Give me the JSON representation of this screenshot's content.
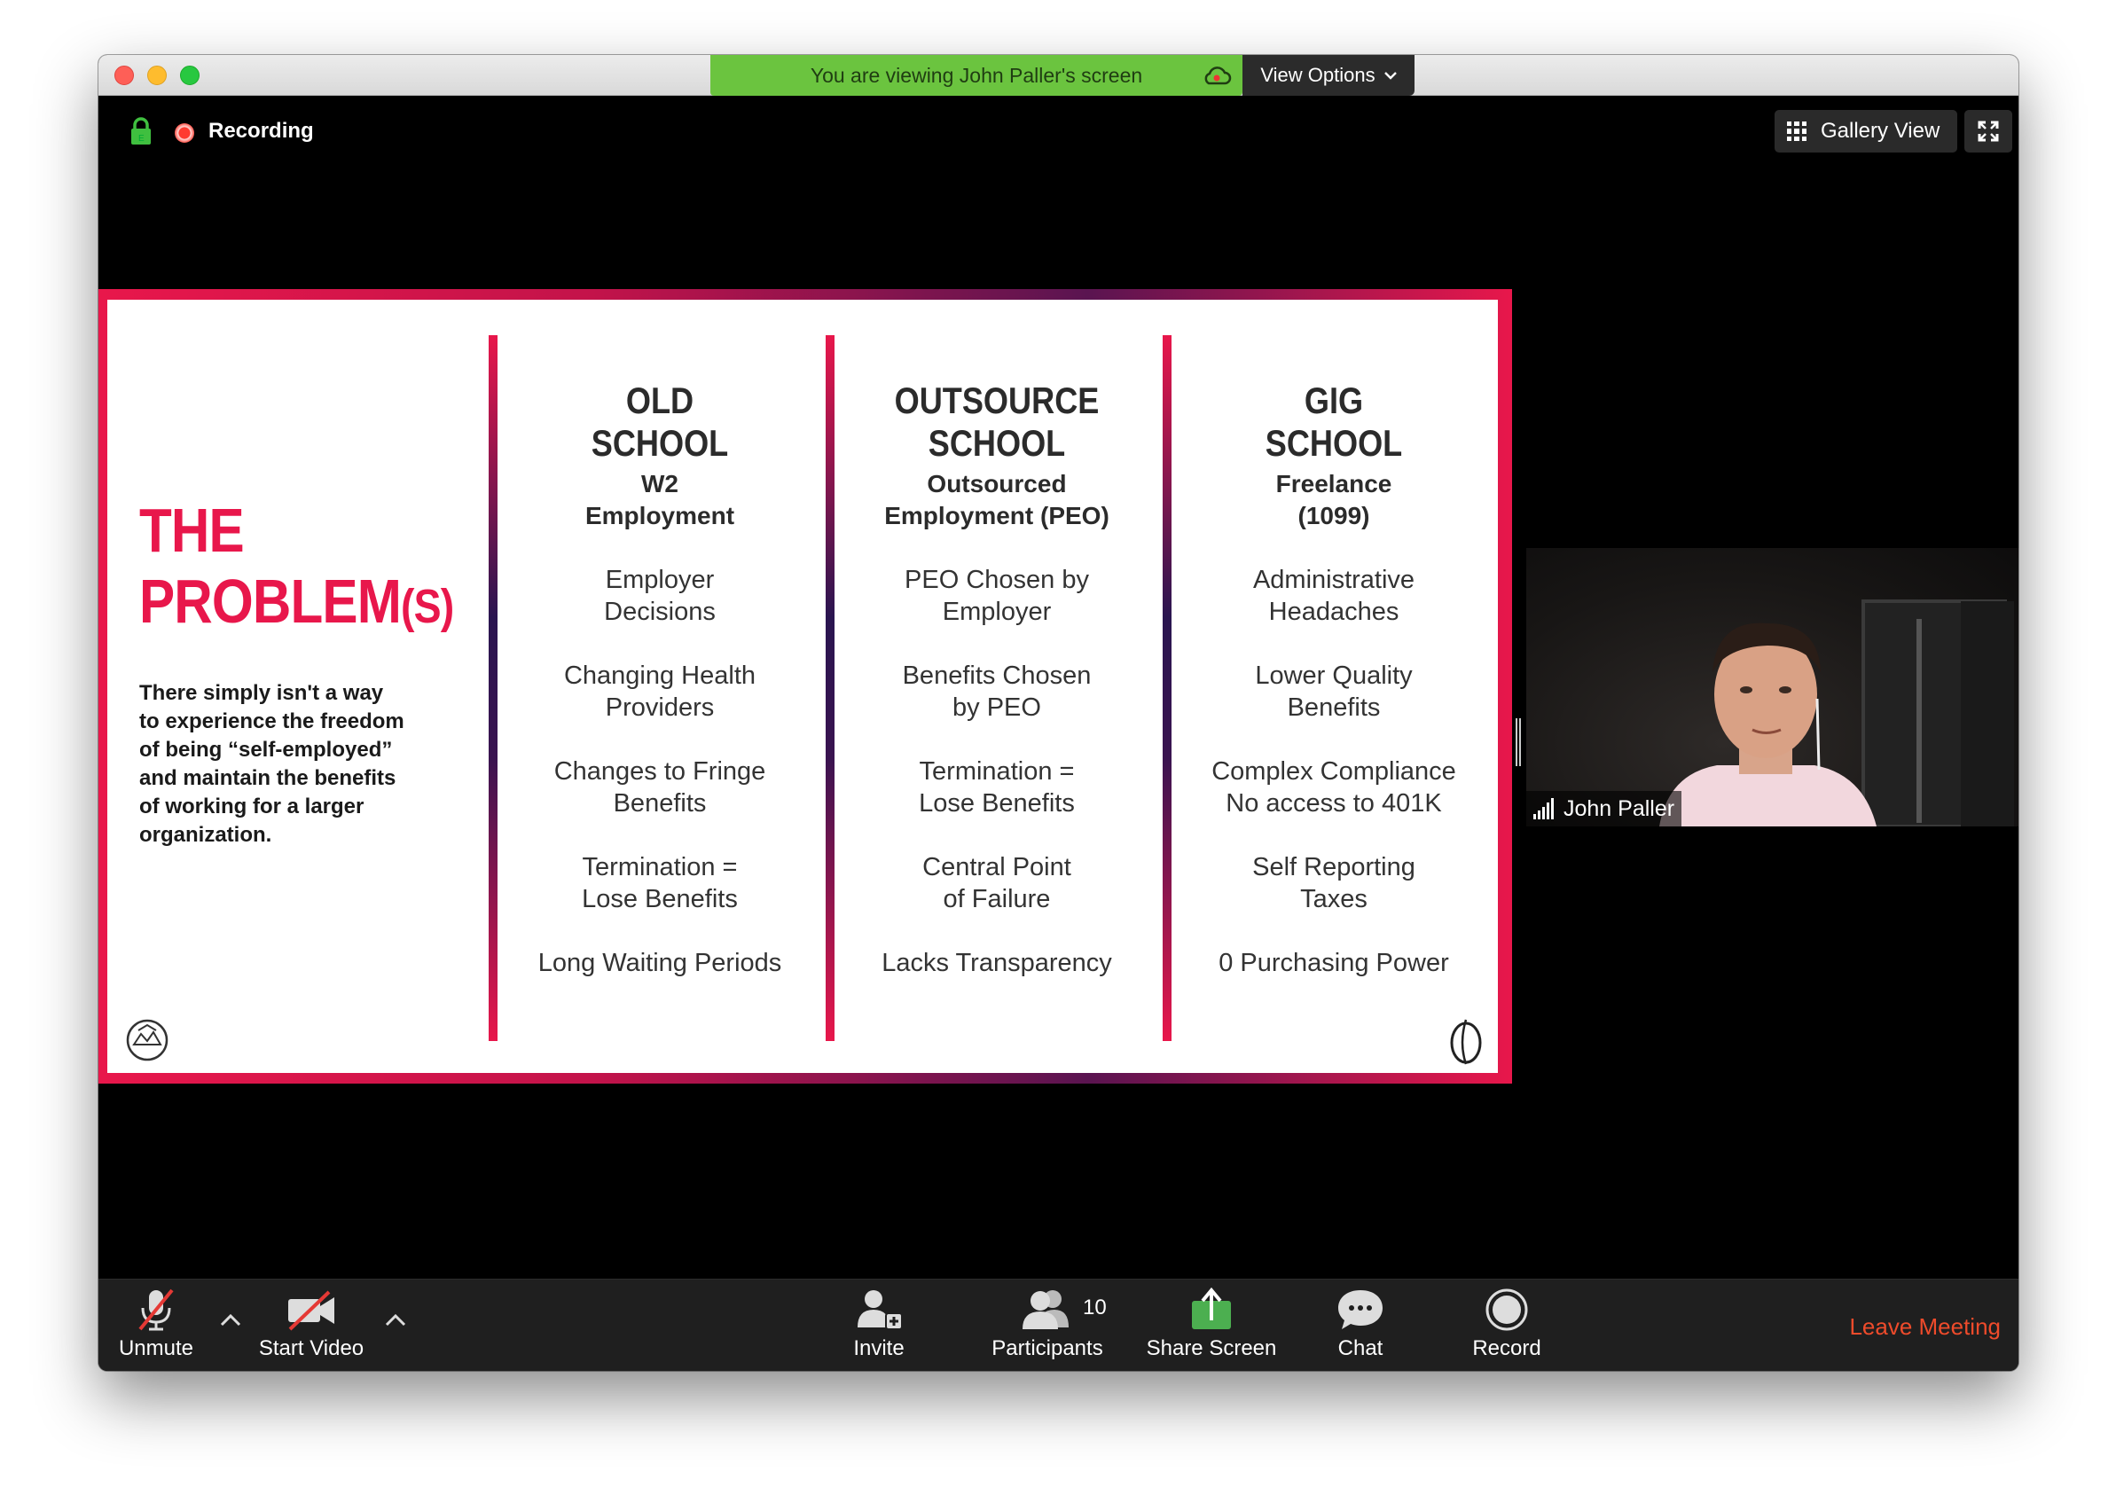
{
  "titlebar": {
    "share_banner": "You are viewing John Paller's screen",
    "view_options": "View Options"
  },
  "status": {
    "recording": "Recording"
  },
  "view_controls": {
    "gallery": "Gallery View"
  },
  "slide": {
    "title_main": "THE",
    "title_second": "PROBLEM",
    "title_suffix": "(S)",
    "description": "There simply isn't a way to experience the freedom of being “self-employed” and maintain the benefits of working for a larger organization.",
    "columns": [
      {
        "head1": "OLD",
        "head2": "SCHOOL",
        "sub1": "W2",
        "sub2": "Employment",
        "items": [
          [
            "Employer",
            "Decisions"
          ],
          [
            "Changing Health",
            "Providers"
          ],
          [
            "Changes to Fringe",
            "Benefits"
          ],
          [
            "Termination =",
            "Lose Benefits"
          ],
          [
            "Long Waiting Periods"
          ]
        ]
      },
      {
        "head1": "OUTSOURCE",
        "head2": "SCHOOL",
        "sub1": "Outsourced",
        "sub2": "Employment (PEO)",
        "items": [
          [
            "PEO Chosen by",
            "Employer"
          ],
          [
            "Benefits Chosen",
            "by PEO"
          ],
          [
            "Termination =",
            "Lose Benefits"
          ],
          [
            "Central Point",
            "of Failure"
          ],
          [
            "Lacks Transparency"
          ]
        ]
      },
      {
        "head1": "GIG",
        "head2": "SCHOOL",
        "sub1": "Freelance",
        "sub2": "(1099)",
        "items": [
          [
            "Administrative",
            "Headaches"
          ],
          [
            "Lower Quality",
            "Benefits"
          ],
          [
            "Complex Compliance",
            "No access to 401K"
          ],
          [
            "Self Reporting",
            "Taxes"
          ],
          [
            "0 Purchasing Power"
          ]
        ]
      }
    ]
  },
  "video": {
    "participant_name": "John Paller"
  },
  "toolbar": {
    "unmute": "Unmute",
    "start_video": "Start Video",
    "invite": "Invite",
    "participants": "Participants",
    "participant_count": "10",
    "share_screen": "Share Screen",
    "chat": "Chat",
    "record": "Record",
    "leave": "Leave Meeting"
  },
  "colors": {
    "accent": "#e8174b",
    "share_green": "#6bc43f",
    "leave_red": "#ee4b2b"
  }
}
